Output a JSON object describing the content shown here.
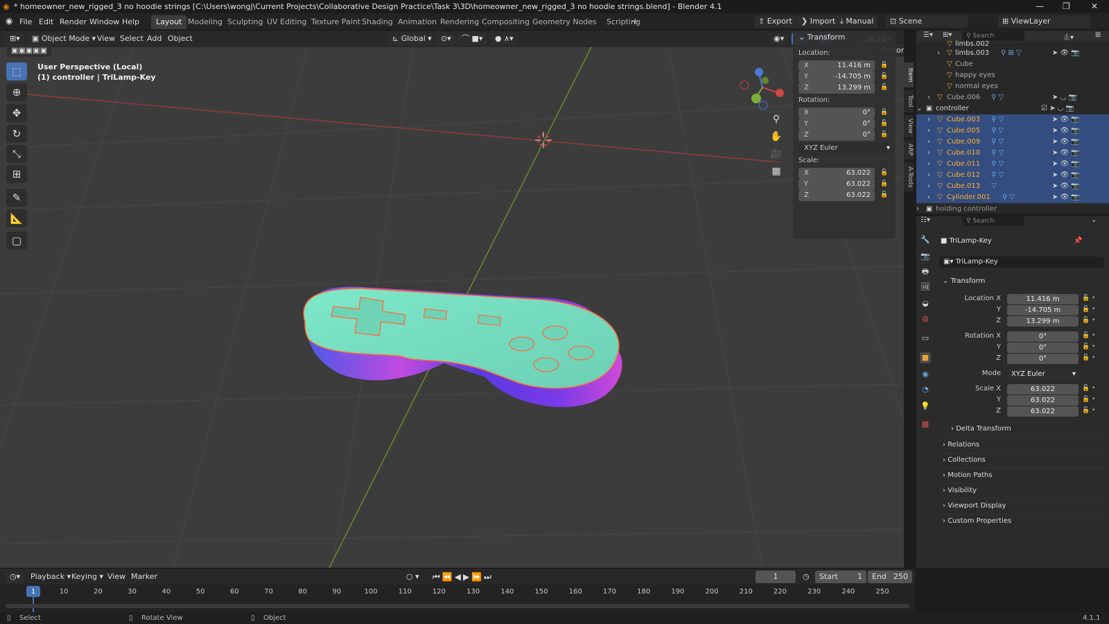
{
  "window": {
    "title": "* homeowner_new_rigged_3 no hoodie strings [C:\\Users\\wongj\\Current Projects\\Collaborative Design Practice\\Task 3\\3D\\homeowner_new_rigged_3 no hoodie strings.blend] - Blender 4.1"
  },
  "menu": [
    "File",
    "Edit",
    "Render",
    "Window",
    "Help"
  ],
  "workspaces": [
    "Layout",
    "Modeling",
    "Sculpting",
    "UV Editing",
    "Texture Paint",
    "Shading",
    "Animation",
    "Rendering",
    "Compositing",
    "Geometry Nodes",
    "Scripting"
  ],
  "topright": {
    "export": "Export",
    "import": "Import",
    "manual": "Manual",
    "scene": "Scene",
    "viewlayer": "ViewLayer"
  },
  "viewport": {
    "mode": "Object Mode",
    "menus": [
      "View",
      "Select",
      "Add",
      "Object"
    ],
    "orientation": "Global",
    "options": "Options",
    "perspective": "User Perspective (Local)",
    "context": "(1) controller | TriLamp-Key"
  },
  "npanel": {
    "title": "Transform",
    "location_label": "Location:",
    "rotation_label": "Rotation:",
    "scale_label": "Scale:",
    "loc": [
      "11.416 m",
      "-14.705 m",
      "13.299 m"
    ],
    "rot": [
      "0°",
      "0°",
      "0°"
    ],
    "scale": [
      "63.022",
      "63.022",
      "63.022"
    ],
    "rotmode": "XYZ Euler",
    "axes": [
      "X",
      "Y",
      "Z"
    ],
    "tabs": [
      "Item",
      "Tool",
      "View",
      "ARP",
      "A-Tools"
    ]
  },
  "outliner": {
    "search": "Search",
    "rows": [
      {
        "name": "limbs.002",
        "sel": false
      },
      {
        "name": "limbs.003",
        "sel": false
      },
      {
        "name": "Cube",
        "sel": false
      },
      {
        "name": "happy eyes",
        "sel": false
      },
      {
        "name": "normal eyes",
        "sel": false
      },
      {
        "name": "Cube.006",
        "sel": false
      },
      {
        "name": "controller",
        "sel": false
      },
      {
        "name": "Cube.003",
        "sel": true
      },
      {
        "name": "Cube.005",
        "sel": true
      },
      {
        "name": "Cube.009",
        "sel": true
      },
      {
        "name": "Cube.010",
        "sel": true
      },
      {
        "name": "Cube.011",
        "sel": true
      },
      {
        "name": "Cube.012",
        "sel": true
      },
      {
        "name": "Cube.013",
        "sel": true
      },
      {
        "name": "Cylinder.001",
        "sel": true
      },
      {
        "name": "holding controller",
        "sel": false
      }
    ]
  },
  "properties": {
    "search": "Search",
    "object_name": "TriLamp-Key",
    "data_name": "TriLamp-Key",
    "transform": "Transform",
    "location_x": "Location X",
    "rotation_x": "Rotation X",
    "scale_x": "Scale X",
    "mode_label": "Mode",
    "y": "Y",
    "z": "Z",
    "loc": [
      "11.416 m",
      "-14.705 m",
      "13.299 m"
    ],
    "rot": [
      "0°",
      "0°",
      "0°"
    ],
    "mode": "XYZ Euler",
    "scale": [
      "63.022",
      "63.022",
      "63.022"
    ],
    "sections": [
      "Delta Transform",
      "Relations",
      "Collections",
      "Motion Paths",
      "Visibility",
      "Viewport Display",
      "Custom Properties"
    ]
  },
  "timeline": {
    "menus": [
      "Playback",
      "Keying",
      "View",
      "Marker"
    ],
    "current": "1",
    "start_label": "Start",
    "start": "1",
    "end_label": "End",
    "end": "250",
    "ticks": [
      "1",
      "10",
      "20",
      "30",
      "40",
      "50",
      "60",
      "70",
      "80",
      "90",
      "100",
      "110",
      "120",
      "130",
      "140",
      "150",
      "160",
      "170",
      "180",
      "190",
      "200",
      "210",
      "220",
      "230",
      "240",
      "250"
    ]
  },
  "status": {
    "select": "Select",
    "rotate": "Rotate View",
    "object": "Object",
    "version": "4.1.1"
  }
}
